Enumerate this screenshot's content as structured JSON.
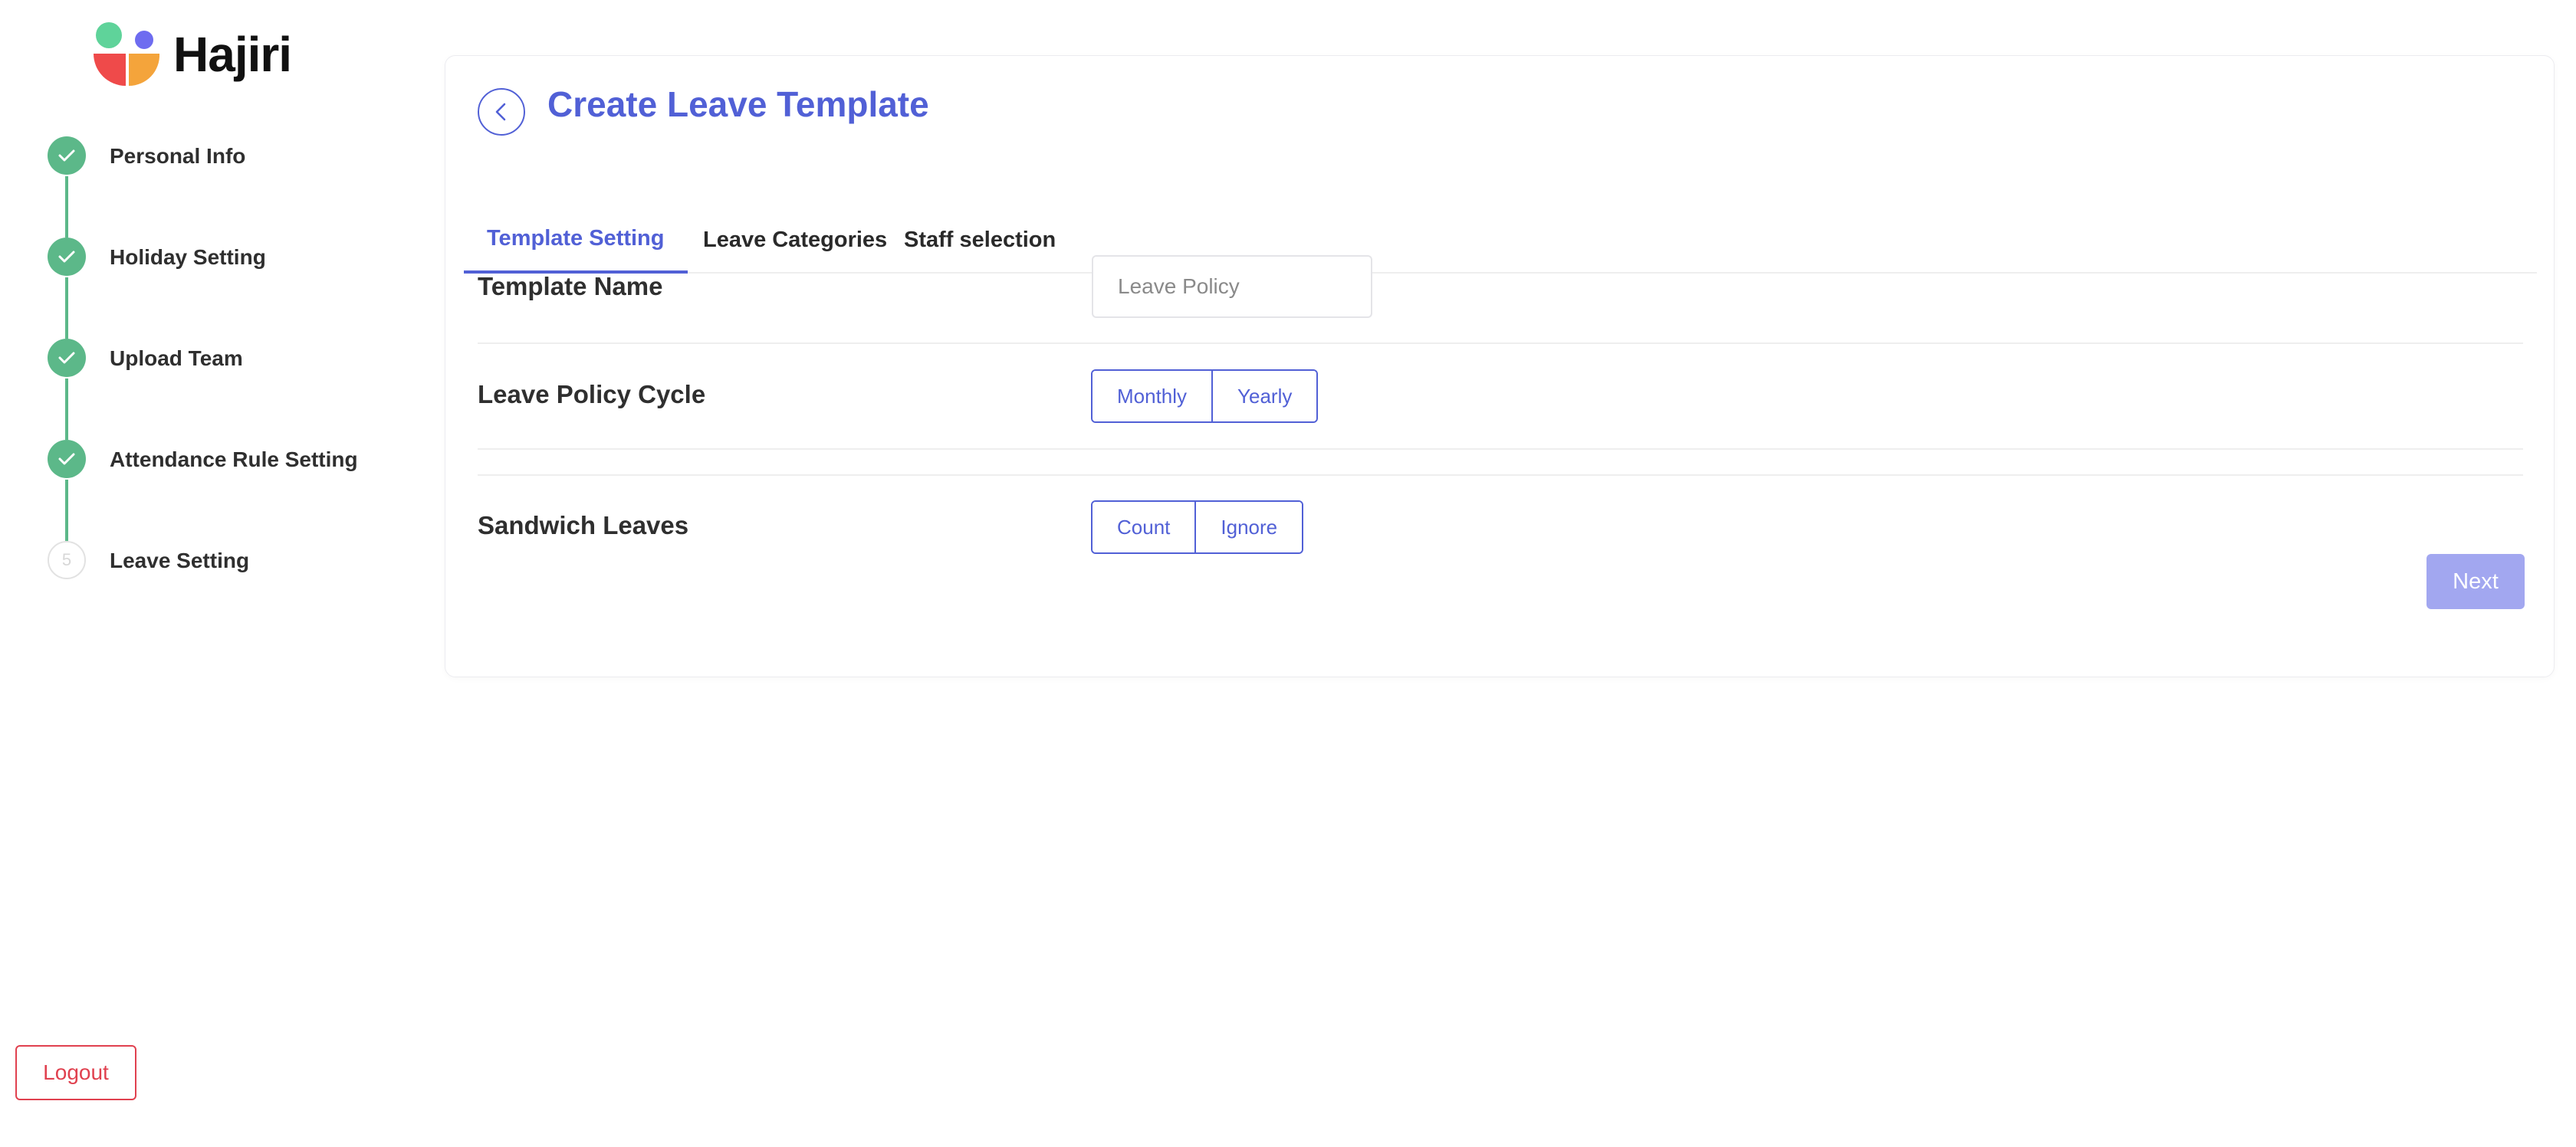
{
  "app": {
    "name": "Hajiri"
  },
  "sidebar": {
    "steps": [
      {
        "label": "Personal Info",
        "status": "done"
      },
      {
        "label": "Holiday Setting",
        "status": "done"
      },
      {
        "label": "Upload Team",
        "status": "done"
      },
      {
        "label": "Attendance Rule Setting",
        "status": "done"
      },
      {
        "label": "Leave Setting",
        "status": "current",
        "number": "5"
      }
    ],
    "logout_label": "Logout"
  },
  "main": {
    "title": "Create Leave Template",
    "tabs": [
      {
        "label": "Template Setting",
        "active": true
      },
      {
        "label": "Leave Categories",
        "active": false
      },
      {
        "label": "Staff selection",
        "active": false
      }
    ],
    "template_name": {
      "label": "Template Name",
      "placeholder": "Leave Policy",
      "value": ""
    },
    "leave_policy_cycle": {
      "label": "Leave Policy Cycle",
      "options": [
        "Monthly",
        "Yearly"
      ]
    },
    "sandwich_leaves": {
      "label": "Sandwich Leaves",
      "options": [
        "Count",
        "Ignore"
      ]
    },
    "next_label": "Next"
  },
  "colors": {
    "accent": "#5160d6",
    "success": "#5cb889",
    "danger": "#e0414f",
    "next_disabled": "#a2a7f0",
    "logo_green": "#5fd39a",
    "logo_blue": "#6e6cf0",
    "logo_red": "#ef4a4a",
    "logo_orange": "#f4a43b"
  }
}
